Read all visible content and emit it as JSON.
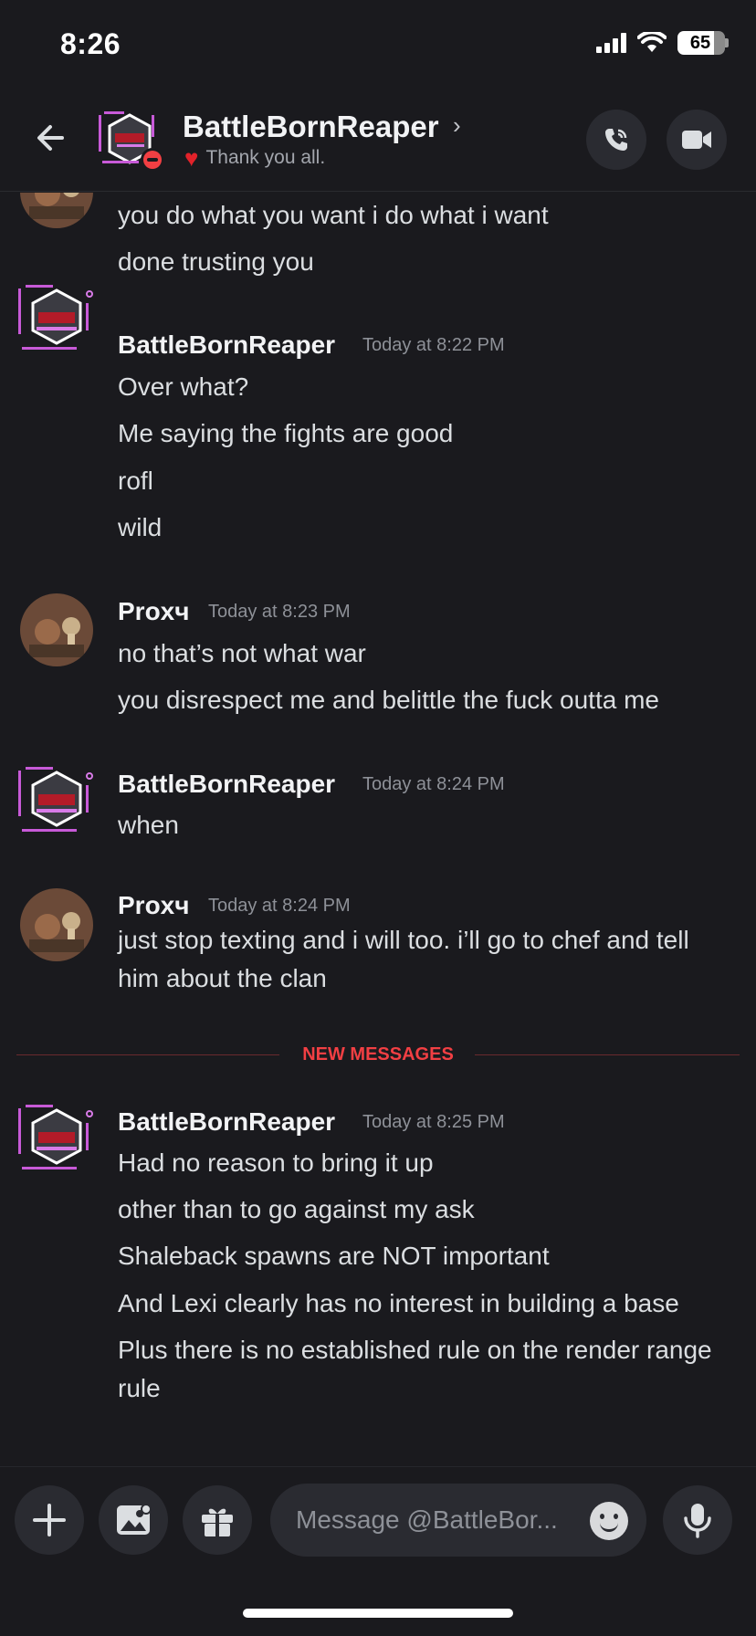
{
  "status_bar": {
    "time": "8:26",
    "battery": "65"
  },
  "header": {
    "name": "BattleBornReaper",
    "chevron": "›",
    "status_text": "Thank you all.",
    "status_emoji": "♥"
  },
  "messages": [
    {
      "type": "continuation",
      "lines": [
        "you do what you want i do what i want",
        "done trusting you"
      ]
    },
    {
      "author": "BattleBornReaper",
      "timestamp": "Today at 8:22 PM",
      "lines": [
        "Over what?",
        "Me saying the fights are good",
        "rofl",
        "wild"
      ]
    },
    {
      "author": "Рroxч",
      "timestamp": "Today at 8:23 PM",
      "lines": [
        "no that’s not what war",
        "you disrespect me and belittle the fuck outta me"
      ]
    },
    {
      "author": "BattleBornReaper",
      "timestamp": "Today at 8:24 PM",
      "lines": [
        "when"
      ]
    },
    {
      "author": "Рroxч",
      "timestamp": "Today at 8:24 PM",
      "lines": [
        "just stop texting and i will too. i’ll go to chef and tell him about the clan"
      ]
    },
    {
      "author": "BattleBornReaper",
      "timestamp": "Today at 8:25 PM",
      "lines": [
        "Had no reason to bring it up",
        "other than to go against my ask",
        "Shaleback spawns are NOT important",
        "And Lexi clearly has no interest in building a base",
        "Plus there is no established rule on the render range rule"
      ]
    }
  ],
  "divider": {
    "label": "NEW MESSAGES"
  },
  "composer": {
    "placeholder": "Message @BattleBor..."
  },
  "icons": [
    "back-arrow-icon",
    "phone-icon",
    "video-icon",
    "plus-icon",
    "image-icon",
    "gift-icon",
    "emoji-icon",
    "microphone-icon"
  ]
}
